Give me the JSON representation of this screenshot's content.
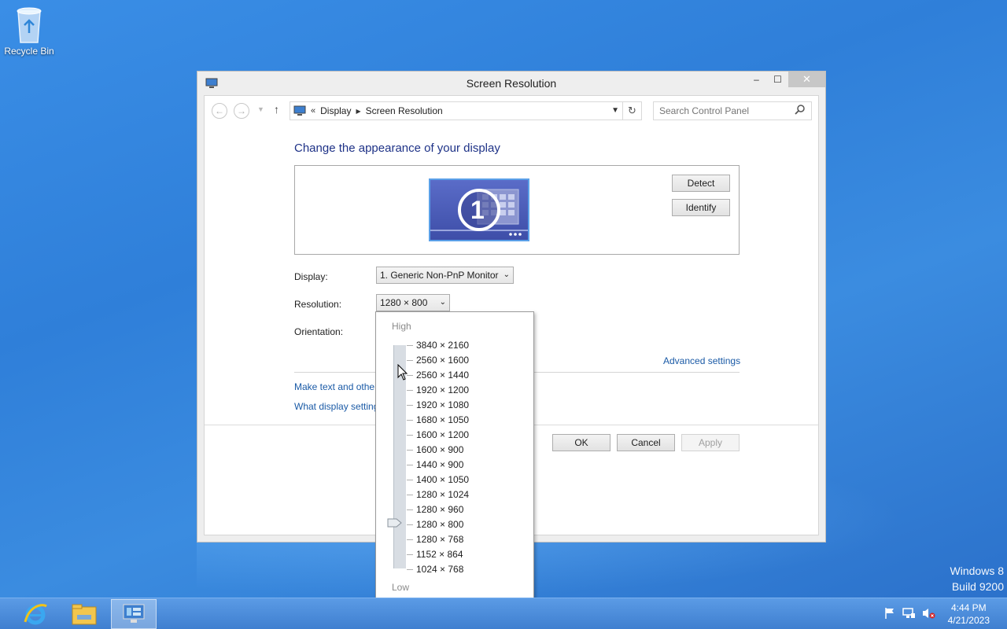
{
  "desktop": {
    "recycle_bin_label": "Recycle Bin",
    "watermark_line1": "Windows 8",
    "watermark_line2": "Build 9200"
  },
  "window": {
    "title": "Screen Resolution",
    "minimize": "–",
    "maximize": "☐",
    "close": "✕"
  },
  "navbar": {
    "crumb_prefix": "«",
    "crumbs": [
      "Display",
      "Screen Resolution"
    ],
    "search_placeholder": "Search Control Panel"
  },
  "main": {
    "heading": "Change the appearance of your display",
    "monitor_number": "1",
    "detect_label": "Detect",
    "identify_label": "Identify",
    "display_label": "Display:",
    "display_value": "1. Generic Non-PnP Monitor",
    "resolution_label": "Resolution:",
    "resolution_value": "1280 × 800",
    "orientation_label": "Orientation:",
    "advanced_settings": "Advanced settings",
    "link_text_size": "Make text and other",
    "link_display_settings": "What display setting",
    "ok_label": "OK",
    "cancel_label": "Cancel",
    "apply_label": "Apply"
  },
  "resolution_dropdown": {
    "high_label": "High",
    "low_label": "Low",
    "selected": "1280 × 800",
    "options": [
      "3840 × 2160",
      "2560 × 1600",
      "2560 × 1440",
      "1920 × 1200",
      "1920 × 1080",
      "1680 × 1050",
      "1600 × 1200",
      "1600 × 900",
      "1440 × 900",
      "1400 × 1050",
      "1280 × 1024",
      "1280 × 960",
      "1280 × 800",
      "1280 × 768",
      "1152 × 864",
      "1024 × 768"
    ]
  },
  "taskbar": {
    "time": "4:44 PM",
    "date": "4/21/2023"
  },
  "colors": {
    "desktop": "#3a8ee6",
    "heading": "#1e3287",
    "link": "#1a5aa6",
    "taskbar": "#4a8ad8"
  }
}
